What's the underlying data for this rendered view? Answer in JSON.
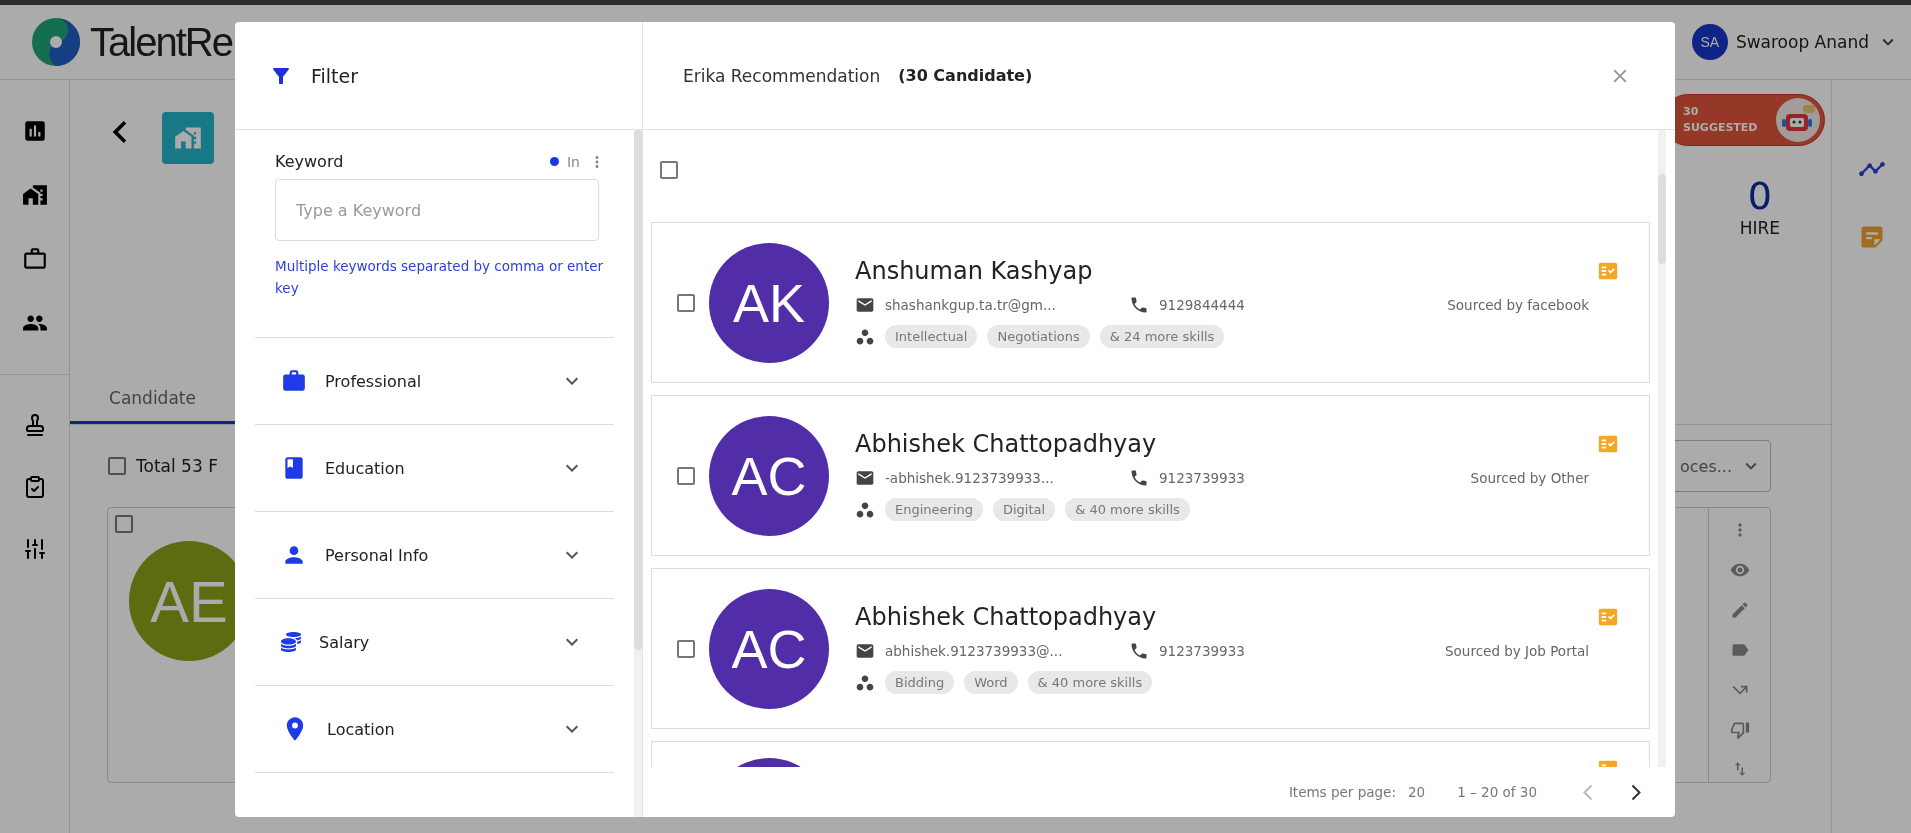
{
  "header": {
    "logo_text": "TalentRe",
    "user": {
      "initials": "SA",
      "name": "Swaroop Anand"
    }
  },
  "background": {
    "tab": {
      "label": "Candidate",
      "selected": true
    },
    "total": {
      "label": "Total 53 F",
      "checked": false
    },
    "card": {
      "initials": "AE",
      "checked": false
    },
    "suggested": {
      "count": "30",
      "label": "SUGGESTED"
    },
    "hire": {
      "count": "0",
      "label": "HIRE"
    },
    "dropdown_value": "oces..."
  },
  "filter": {
    "title": "Filter",
    "keyword": {
      "label": "Keyword",
      "mode": "In",
      "placeholder": "Type a Keyword",
      "hint": "Multiple keywords separated by comma or enter key"
    },
    "sections": [
      {
        "kind": "professional",
        "label": "Professional",
        "expanded": false
      },
      {
        "kind": "education",
        "label": "Education",
        "expanded": false
      },
      {
        "kind": "personal",
        "label": "Personal Info",
        "expanded": false
      },
      {
        "kind": "salary",
        "label": "Salary",
        "expanded": false
      },
      {
        "kind": "location",
        "label": "Location",
        "expanded": false
      }
    ]
  },
  "recommendation": {
    "title": "Erika Recommendation",
    "count": "(30 Candidate)",
    "select_all_checked": false,
    "candidates": [
      {
        "initials": "AK",
        "name": "Anshuman Kashyap",
        "email": "shashankgup.ta.tr@gm...",
        "phone": "9129844444",
        "source": "Sourced by facebook",
        "skills": [
          "Intellectual",
          "Negotiations"
        ],
        "more_skills": "& 24 more skills",
        "checked": false
      },
      {
        "initials": "AC",
        "name": "Abhishek Chattopadhyay",
        "email": "-abhishek.9123739933...",
        "phone": "9123739933",
        "source": "Sourced by Other",
        "skills": [
          "Engineering",
          "Digital"
        ],
        "more_skills": "& 40 more skills",
        "checked": false
      },
      {
        "initials": "AC",
        "name": "Abhishek Chattopadhyay",
        "email": "abhishek.9123739933@...",
        "phone": "9123739933",
        "source": "Sourced by Job Portal",
        "skills": [
          "Bidding",
          "Word"
        ],
        "more_skills": "& 40 more skills",
        "checked": false
      }
    ],
    "pagination": {
      "items_per_page_label": "Items per page:",
      "items_per_page": "20",
      "range": "1 – 20 of 30",
      "prev_disabled": true,
      "next_disabled": false
    }
  }
}
